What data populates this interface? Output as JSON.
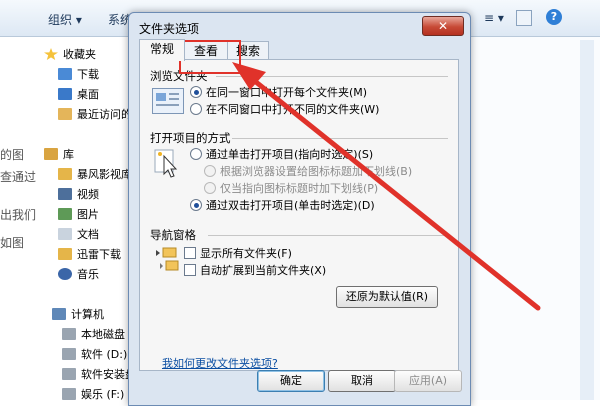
{
  "explorer": {
    "toolbar": {
      "organize": "组织 ▾",
      "system": "系统",
      "extra": "≡ ▾"
    },
    "nav": {
      "favorites": "收藏夹",
      "downloads": "下载",
      "desktop": "桌面",
      "recent": "最近访问的",
      "libraries": "库",
      "storm": "暴风影视库",
      "videos": "视频",
      "pictures": "图片",
      "documents": "文档",
      "xunlei": "迅雷下载",
      "music": "音乐",
      "computer": "计算机",
      "local_disk": "本地磁盘 (C:)",
      "software_d": "软件 (D:)",
      "software_install": "软件安装盘",
      "entertainment": "娱乐 (F:)"
    },
    "fragments": [
      "的图",
      "查通过",
      "出我们",
      "如图"
    ]
  },
  "dialog": {
    "title": "文件夹选项",
    "close": "✕",
    "tabs": {
      "general": "常规",
      "view": "查看",
      "search": "搜索"
    },
    "browse": {
      "title": "浏览文件夹",
      "same_window": "在同一窗口中打开每个文件夹(M)",
      "new_window": "在不同窗口中打开不同的文件夹(W)"
    },
    "click": {
      "title": "打开项目的方式",
      "single": "通过单击打开项目(指向时选定)(S)",
      "underline_browser": "根据浏览器设置给图标标题加下划线(B)",
      "underline_point": "仅当指向图标标题时加下划线(P)",
      "double": "通过双击打开项目(单击时选定)(D)"
    },
    "nav_pane": {
      "title": "导航窗格",
      "show_all": "显示所有文件夹(F)",
      "auto_expand": "自动扩展到当前文件夹(X)"
    },
    "restore": "还原为默认值(R)",
    "help_link": "我如何更改文件夹选项?",
    "buttons": {
      "ok": "确定",
      "cancel": "取消",
      "apply": "应用(A)"
    }
  },
  "colors": {
    "highlight": "#e0322a",
    "link": "#0b4ea2"
  }
}
